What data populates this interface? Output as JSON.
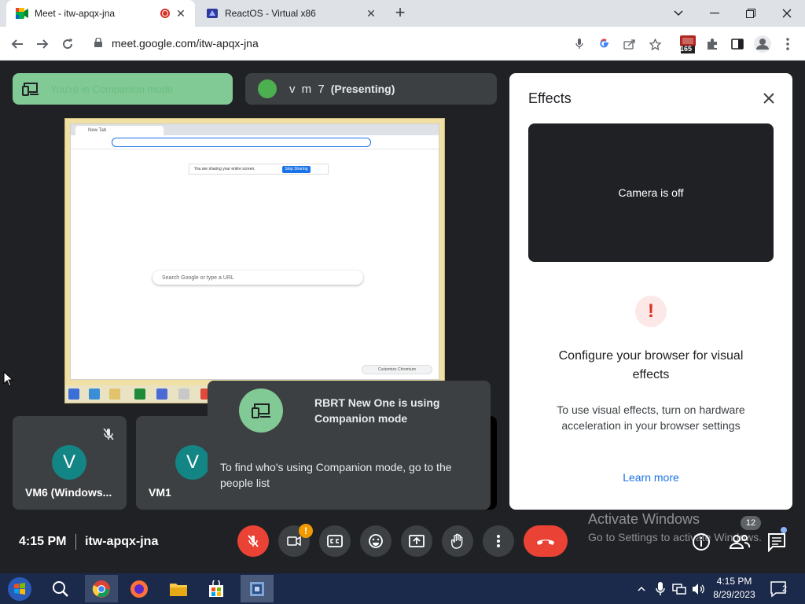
{
  "browser": {
    "tabs": [
      {
        "title": "Meet - itw-apqx-jna",
        "active": true
      },
      {
        "title": "ReactOS - Virtual x86",
        "active": false
      }
    ],
    "url": "meet.google.com/itw-apqx-jna",
    "extension_badge": "165"
  },
  "meet": {
    "companion_pill_text": "You're in Companion mode",
    "presenter_name": "v m 7",
    "presenting_label": "(Presenting)",
    "shared_screen": {
      "tab_title": "New Tab",
      "share_notice": "You are sharing your entire screen.",
      "stop_sharing": "Stop Sharing",
      "search_placeholder": "Search Google or type a URL",
      "customize": "Customize Chromium"
    },
    "tiles": [
      {
        "initial": "V",
        "name": "VM6 (Windows..."
      },
      {
        "initial": "V",
        "name": "VM1"
      }
    ],
    "toast": {
      "title": "RBRT New One is using Companion mode",
      "body": "To find who's using Companion mode, go to the people list"
    },
    "group_initials": [
      "V",
      "V"
    ],
    "effects": {
      "title": "Effects",
      "camera_status": "Camera is off",
      "heading": "Configure your browser for visual effects",
      "description": "To use visual effects, turn on hardware acceleration in your browser settings",
      "link": "Learn more"
    },
    "bottom": {
      "time": "4:15 PM",
      "meeting_code": "itw-apqx-jna",
      "camera_badge": "!",
      "people_count": "12"
    }
  },
  "watermark": {
    "line1": "Activate Windows",
    "line2": "Go to Settings to activate Windows."
  },
  "taskbar": {
    "time": "4:15 PM",
    "date": "8/29/2023",
    "notification_count": "2"
  },
  "colors": {
    "meet_bg": "#202124",
    "tile_bg": "#3c4043",
    "red": "#ea4335",
    "companion_green": "#81c995",
    "avatar_teal": "#138585",
    "link_blue": "#1a73e8"
  }
}
